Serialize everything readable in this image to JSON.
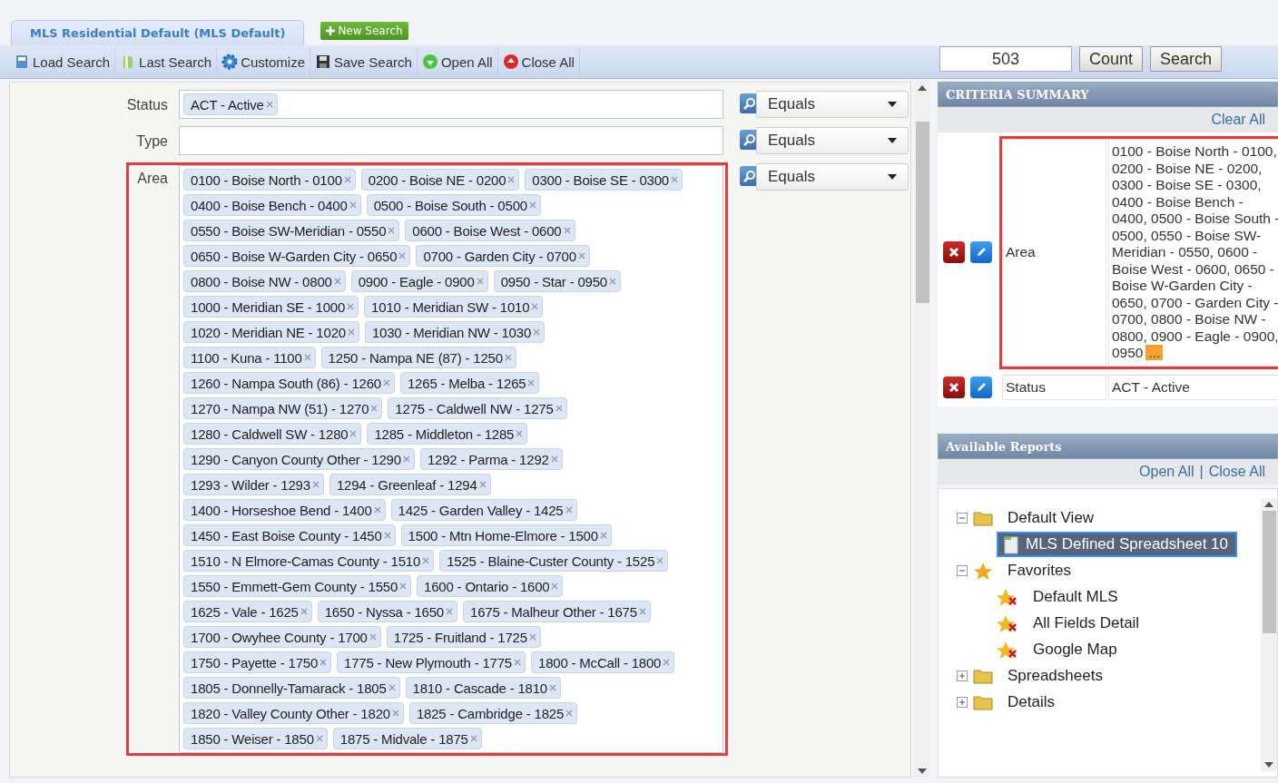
{
  "tab": {
    "label": "MLS Residential Default (MLS Default)",
    "selected": true
  },
  "new_search": {
    "label": "New Search"
  },
  "toolbar": [
    {
      "label": "Load Search",
      "kind": "load"
    },
    {
      "label": "Last Search",
      "kind": "last"
    },
    {
      "label": "Customize",
      "kind": "gear"
    },
    {
      "label": "Save Search",
      "kind": "save"
    },
    {
      "label": "Open All",
      "kind": "open"
    },
    {
      "label": "Close All",
      "kind": "close"
    }
  ],
  "count": {
    "value": "503"
  },
  "buttons": [
    "Count",
    "Search"
  ],
  "criteria": [
    {
      "label": "Status",
      "operator": "Equals",
      "highlighted": false,
      "tag_rows": [
        [
          "ACT - Active"
        ]
      ]
    },
    {
      "label": "Type",
      "operator": "Equals",
      "highlighted": false
    },
    {
      "label": "Area",
      "operator": "Equals",
      "highlighted": true,
      "tag_rows": [
        [
          "0100 - Boise North - 0100",
          "0200 - Boise NE - 0200",
          "0300 - Boise SE - 0300"
        ],
        [
          "0400 - Boise Bench - 0400",
          "0500 - Boise South - 0500"
        ],
        [
          "0550 - Boise SW-Meridian - 0550",
          "0600 - Boise West - 0600"
        ],
        [
          "0650 - Boise W-Garden City - 0650",
          "0700 - Garden City - 0700"
        ],
        [
          "0800 - Boise NW - 0800",
          "0900 - Eagle - 0900",
          "0950 - Star - 0950"
        ],
        [
          "1000 - Meridian SE - 1000",
          "1010 - Meridian SW - 1010"
        ],
        [
          "1020 - Meridian NE - 1020",
          "1030 - Meridian NW - 1030"
        ],
        [
          "1100 - Kuna - 1100",
          "1250 - Nampa NE (87) - 1250"
        ],
        [
          "1260 - Nampa South (86) - 1260",
          "1265 - Melba - 1265"
        ],
        [
          "1270 - Nampa NW (51) - 1270",
          "1275 - Caldwell NW - 1275"
        ],
        [
          "1280 - Caldwell SW - 1280",
          "1285 - Middleton - 1285"
        ],
        [
          "1290 - Canyon County Other - 1290",
          "1292 - Parma - 1292"
        ],
        [
          "1293 - Wilder - 1293",
          "1294 - Greenleaf - 1294"
        ],
        [
          "1400 - Horseshoe Bend - 1400",
          "1425 - Garden Valley - 1425"
        ],
        [
          "1450 - East Boise County - 1450",
          "1500 - Mtn Home-Elmore - 1500"
        ],
        [
          "1510 - N Elmore-Camas County - 1510",
          "1525 - Blaine-Custer County - 1525"
        ],
        [
          "1550 - Emmett-Gem County - 1550",
          "1600 - Ontario - 1600"
        ],
        [
          "1625 - Vale - 1625",
          "1650 - Nyssa - 1650",
          "1675 - Malheur Other - 1675"
        ],
        [
          "1700 - Owyhee County - 1700",
          "1725 - Fruitland - 1725"
        ],
        [
          "1750 - Payette - 1750",
          "1775 - New Plymouth - 1775",
          "1800 - McCall - 1800"
        ],
        [
          "1805 - Donnelly-Tamarack - 1805",
          "1810 - Cascade - 1810"
        ],
        [
          "1820 - Valley County Other - 1820",
          "1825 - Cambridge - 1825"
        ],
        [
          "1850 - Weiser - 1850",
          "1875 - Midvale - 1875"
        ]
      ]
    }
  ],
  "summary": {
    "title": "CRITERIA SUMMARY",
    "clear_all": "Clear All",
    "rows": [
      {
        "field": "Area",
        "value": "0100 - Boise North - 0100, 0200 - Boise NE - 0200, 0300 - Boise SE - 0300, 0400 - Boise Bench - 0400, 0500 - Boise South - 0500, 0550 - Boise SW-Meridian - 0550, 0600 - Boise West - 0600, 0650 - Boise W-Garden City - 0650, 0700 - Garden City - 0700, 0800 - Boise NW - 0800, 0900 - Eagle - 0900, 0950",
        "more": "...",
        "highlighted": true
      },
      {
        "field": "Status",
        "value": "ACT - Active",
        "highlighted": false
      }
    ]
  },
  "reports": {
    "title": "Available Reports",
    "links": [
      "Open All",
      "Close All"
    ],
    "separator": "|",
    "tree": [
      {
        "label": "Default View",
        "kind": "folder",
        "expanded": true,
        "selected": false,
        "children": [
          {
            "label": "MLS Defined Spreadsheet 10",
            "kind": "sheet",
            "selected": true
          }
        ]
      },
      {
        "label": "Favorites",
        "kind": "star",
        "expanded": true,
        "selected": false,
        "children": [
          {
            "label": "Default MLS",
            "kind": "favorite",
            "selected": false
          },
          {
            "label": "All Fields Detail",
            "kind": "favorite",
            "selected": false
          },
          {
            "label": "Google Map",
            "kind": "favorite",
            "selected": false
          }
        ]
      },
      {
        "label": "Spreadsheets",
        "kind": "folder",
        "expanded": false,
        "selected": false
      },
      {
        "label": "Details",
        "kind": "folder",
        "expanded": false,
        "selected": false
      }
    ]
  }
}
